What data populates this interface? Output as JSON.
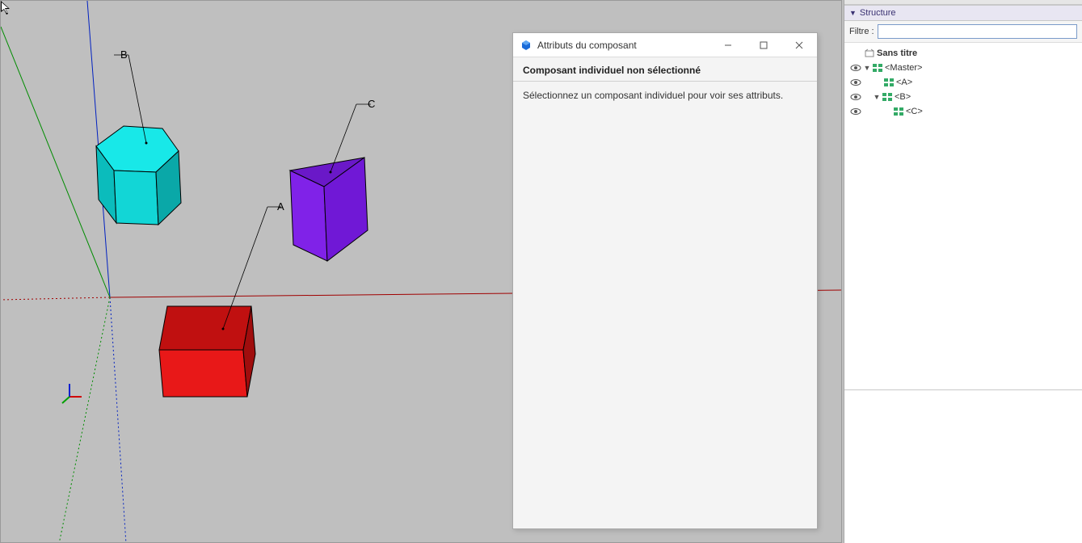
{
  "viewport": {
    "labels": {
      "A": "A",
      "B": "B",
      "C": "C"
    }
  },
  "dialog": {
    "title": "Attributs du composant",
    "header": "Composant individuel non sélectionné",
    "body": "Sélectionnez un composant individuel pour voir ses attributs."
  },
  "panel": {
    "section_title": "Structure",
    "filter_label": "Filtre :",
    "filter_value": "",
    "root_title": "Sans titre",
    "tree": {
      "master": "<Master>",
      "a": "<A>",
      "b": "<B>",
      "c": "<C>"
    }
  }
}
